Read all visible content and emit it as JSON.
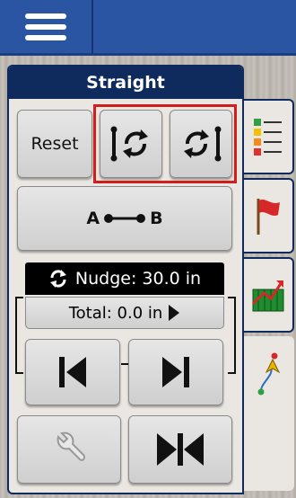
{
  "panel": {
    "title": "Straight"
  },
  "buttons": {
    "reset": "Reset",
    "ab_a": "A",
    "ab_b": "B"
  },
  "nudge": {
    "label": "Nudge: 30.0 in"
  },
  "total": {
    "label": "Total: 0.0 in"
  },
  "icons": {
    "menu": "hamburger-icon",
    "shift_left_line": "rotate-line-left-icon",
    "shift_right_line": "rotate-line-right-icon",
    "ab_line": "ab-line-icon",
    "nudge": "refresh-icon",
    "total_arrow": "play-triangle-icon",
    "nudge_left": "nudge-left-icon",
    "nudge_right": "nudge-right-icon",
    "settings": "wrench-icon",
    "center": "center-line-icon",
    "tab_list": "checklist-icon",
    "tab_flag": "flag-icon",
    "tab_field": "field-graph-icon",
    "tab_guidance": "guidance-icon"
  },
  "colors": {
    "header": "#2a55a3",
    "panel_title": "#0f2a5c",
    "highlight": "#d21d1d"
  }
}
